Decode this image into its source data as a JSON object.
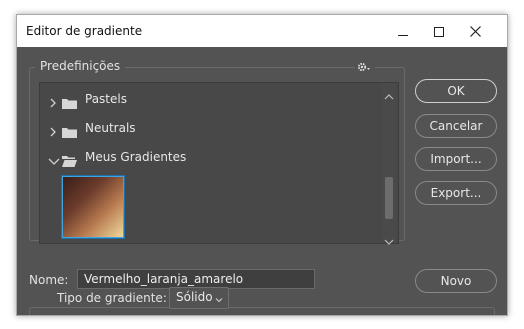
{
  "window": {
    "title": "Editor de gradiente",
    "controls": {
      "minimize": "minimize",
      "maximize": "maximize",
      "close": "close"
    }
  },
  "presets": {
    "label": "Predefinições",
    "items": [
      {
        "label": "Pastels",
        "expanded": false
      },
      {
        "label": "Neutrals",
        "expanded": false
      },
      {
        "label": "Meus Gradientes",
        "expanded": true
      }
    ],
    "selected_gradient": {
      "colors": [
        "#3a1e19",
        "#6b3b2b",
        "#b77a4f",
        "#f0d89c"
      ]
    }
  },
  "buttons": {
    "ok": "OK",
    "cancel": "Cancelar",
    "import": "Import...",
    "export": "Export...",
    "new": "Novo"
  },
  "name_field": {
    "label": "Nome:",
    "value": "Vermelho_laranja_amarelo"
  },
  "gradient_type": {
    "label": "Tipo de gradiente:",
    "value": "Sólido"
  },
  "colors": {
    "dialog_bg": "#535353",
    "list_bg": "#484848",
    "selection_border": "#3fa4e0"
  }
}
